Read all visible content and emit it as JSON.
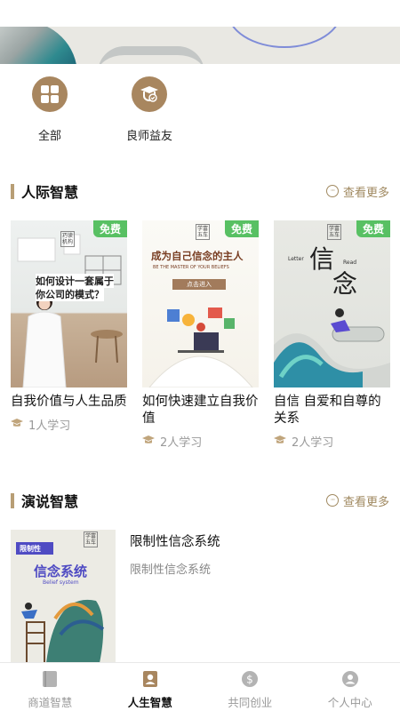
{
  "categories": [
    {
      "label": "全部",
      "icon": "grid-icon"
    },
    {
      "label": "良师益友",
      "icon": "mentor-icon"
    }
  ],
  "sections": [
    {
      "title": "人际智慧",
      "see_more": "查看更多",
      "cards": [
        {
          "badge": "免费",
          "title": "自我价值与人生品质",
          "learners": "1人学习",
          "cover_text": {
            "tag": "巧读\n机构",
            "line1": "如何设计一套属于",
            "line2": "你公司的模式？"
          }
        },
        {
          "badge": "免费",
          "title": "如何快速建立自我价值",
          "learners": "2人学习",
          "cover_text": {
            "tag": "学富\n五车",
            "heading": "成为自己信念的主人",
            "sub": "BE THE MASTER OF YOUR BELIEFS",
            "button": "点击进入"
          }
        },
        {
          "badge": "免费",
          "title": "自信 自爱和自尊的关系",
          "learners": "2人学习",
          "cover_text": {
            "tag": "学富\n五车",
            "big1": "信",
            "big2": "念",
            "letter": "Letter",
            "read": "Read"
          }
        }
      ]
    },
    {
      "title": "演说智慧",
      "see_more": "查看更多",
      "item": {
        "title": "限制性信念系统",
        "subtitle": "限制性信念系统",
        "cover_text": {
          "tag": "学富\n五车",
          "ribbon": "限制性",
          "heading": "信念系统",
          "sub": "Belief system"
        }
      }
    }
  ],
  "tabs": [
    {
      "label": "商道智慧",
      "icon": "book-icon",
      "active": false
    },
    {
      "label": "人生智慧",
      "icon": "profile-card-icon",
      "active": true
    },
    {
      "label": "共同创业",
      "icon": "dollar-coin-icon",
      "active": false
    },
    {
      "label": "个人中心",
      "icon": "user-icon",
      "active": false
    }
  ],
  "colors": {
    "accent": "#a8865f",
    "free_badge": "#58c063",
    "see_more": "#a08960",
    "inactive_tab": "#999999"
  }
}
